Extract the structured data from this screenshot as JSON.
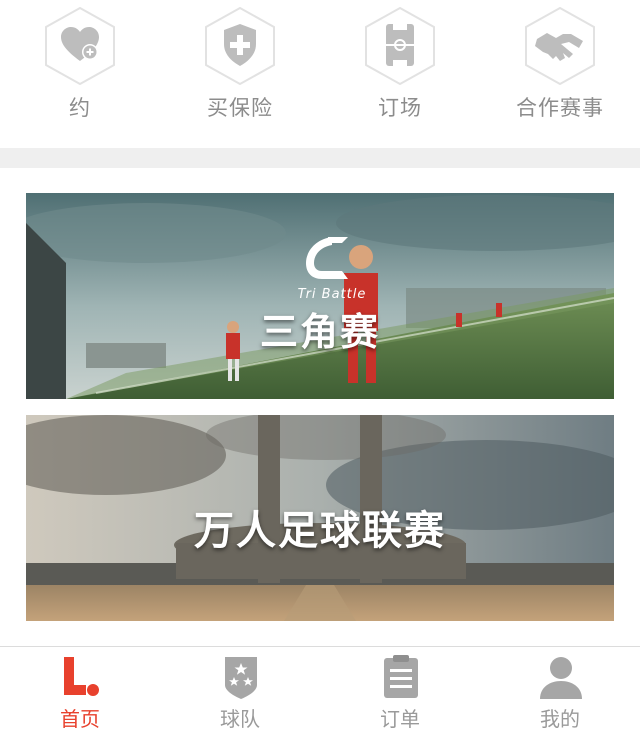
{
  "quick_actions": [
    {
      "label": "约",
      "icon": "heart-plus-icon"
    },
    {
      "label": "买保险",
      "icon": "shield-plus-icon"
    },
    {
      "label": "订场",
      "icon": "pitch-icon"
    },
    {
      "label": "合作赛事",
      "icon": "handshake-icon"
    }
  ],
  "banners": [
    {
      "title": "三角赛",
      "brand": "Tri Battle"
    },
    {
      "title": "万人足球联赛"
    }
  ],
  "tabs": [
    {
      "label": "首页",
      "icon": "home-logo-icon",
      "active": true
    },
    {
      "label": "球队",
      "icon": "team-badge-icon",
      "active": false
    },
    {
      "label": "订单",
      "icon": "order-clipboard-icon",
      "active": false
    },
    {
      "label": "我的",
      "icon": "user-icon",
      "active": false
    }
  ],
  "colors": {
    "accent": "#e8412d",
    "icon_gray": "#9a9a9a",
    "background_band": "#efefef"
  }
}
